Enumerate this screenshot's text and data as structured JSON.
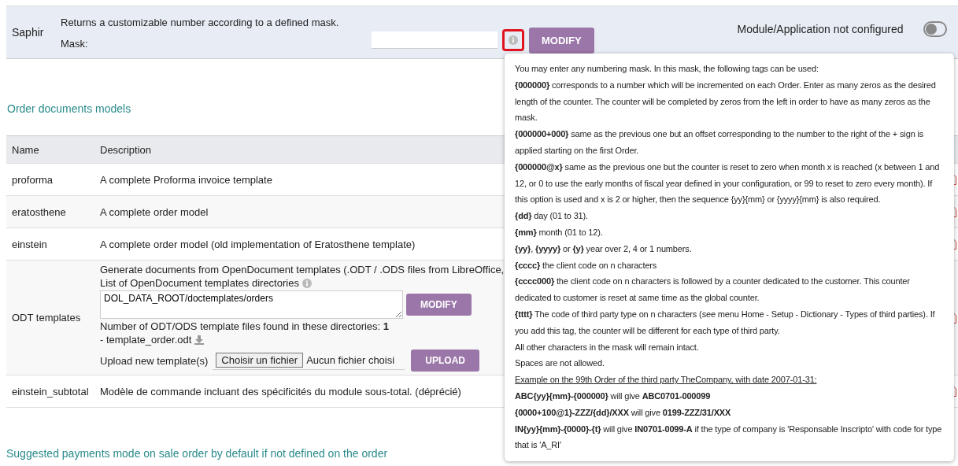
{
  "numbering": {
    "name": "Saphir",
    "description": "Returns a customizable number according to a defined mask.",
    "mask_label": "Mask:",
    "button": "MODIFY",
    "status": "Module/Application not configured",
    "on": false
  },
  "section_title": "Order documents models",
  "table": {
    "columns": [
      "Name",
      "Description"
    ],
    "rows": [
      {
        "kind": "plain",
        "name": "proforma",
        "description": "A complete Proforma invoice template"
      },
      {
        "kind": "plain",
        "name": "eratosthene",
        "description": "A complete order model"
      },
      {
        "kind": "plain",
        "name": "einstein",
        "description": "A complete order model (old implementation of Eratosthene template)"
      },
      {
        "kind": "odt",
        "name": "ODT templates",
        "intro": "Generate documents from OpenDocument templates (.ODT / .ODS files from LibreOffice,",
        "dirs_label": "List of OpenDocument templates directories",
        "dirs_value": "DOL_DATA_ROOT/doctemplates/orders",
        "modify": "MODIFY",
        "found": "Number of ODT/ODS template files found in these directories: **1**",
        "file": "- template_order.odt",
        "upload_label": "Upload new template(s)",
        "choose": "Choisir un fichier",
        "no_file": "Aucun fichier choisi",
        "upload": "UPLOAD"
      },
      {
        "kind": "plain",
        "name": "einstein_subtotal",
        "description": "Modèle de commande incluant des spécificités du module sous-total. (déprécié)"
      }
    ]
  },
  "tooltip": [
    {
      "kind": "text",
      "text": "You may enter any numbering mask. In this mask, the following tags can be used:"
    },
    {
      "kind": "text",
      "text": "**{000000}** corresponds to a number which will be incremented on each Order. Enter as many zeros as the desired length of the counter. The counter will be completed by zeros from the left in order to have as many zeros as the mask."
    },
    {
      "kind": "text",
      "text": "**{000000+000}** same as the previous one but an offset corresponding to the number to the right of the + sign is applied starting on the first Order."
    },
    {
      "kind": "text",
      "text": "**{000000@x}** same as the previous one but the counter is reset to zero when month x is reached (x between 1 and 12, or 0 to use the early months of fiscal year defined in your configuration, or 99 to reset to zero every month). If this option is used and x is 2 or higher, then the sequence {yy}{mm} or {yyyy}{mm} is also required."
    },
    {
      "kind": "text",
      "text": "**{dd}** day (01 to 31)."
    },
    {
      "kind": "text",
      "text": "**{mm}** month (01 to 12)."
    },
    {
      "kind": "text",
      "text": "**{yy}**, **{yyyy}** or **{y}** year over 2, 4 or 1 numbers."
    },
    {
      "kind": "text",
      "text": "**{cccc}** the client code on n characters"
    },
    {
      "kind": "text",
      "text": "**{cccc000}** the client code on n characters is followed by a counter dedicated to the customer. This counter dedicated to customer is reset at same time as the global counter."
    },
    {
      "kind": "text",
      "text": "**{tttt}** The code of third party type on n characters (see menu Home - Setup - Dictionary - Types of third parties). If you add this tag, the counter will be different for each type of third party."
    },
    {
      "kind": "text",
      "text": "All other characters in the mask will remain intact."
    },
    {
      "kind": "text",
      "text": "Spaces are not allowed."
    },
    {
      "kind": "example",
      "text": "Example on the 99th Order of the third party TheCompany, with date 2007-01-31:"
    },
    {
      "kind": "text",
      "text": "**ABC{yy}{mm}-{000000}** will give **ABC0701-000099**"
    },
    {
      "kind": "text",
      "text": "**{0000+100@1}-ZZZ/{dd}/XXX** will give **0199-ZZZ/31/XXX**"
    },
    {
      "kind": "text",
      "text": "**IN{yy}{mm}-{0000}-{t}** will give **IN0701-0099-A** if the type of company is 'Responsable Inscripto' with code for type that is 'A_RI'"
    }
  ],
  "footer_link": "Suggested payments mode on sale order by default if not defined on the order"
}
